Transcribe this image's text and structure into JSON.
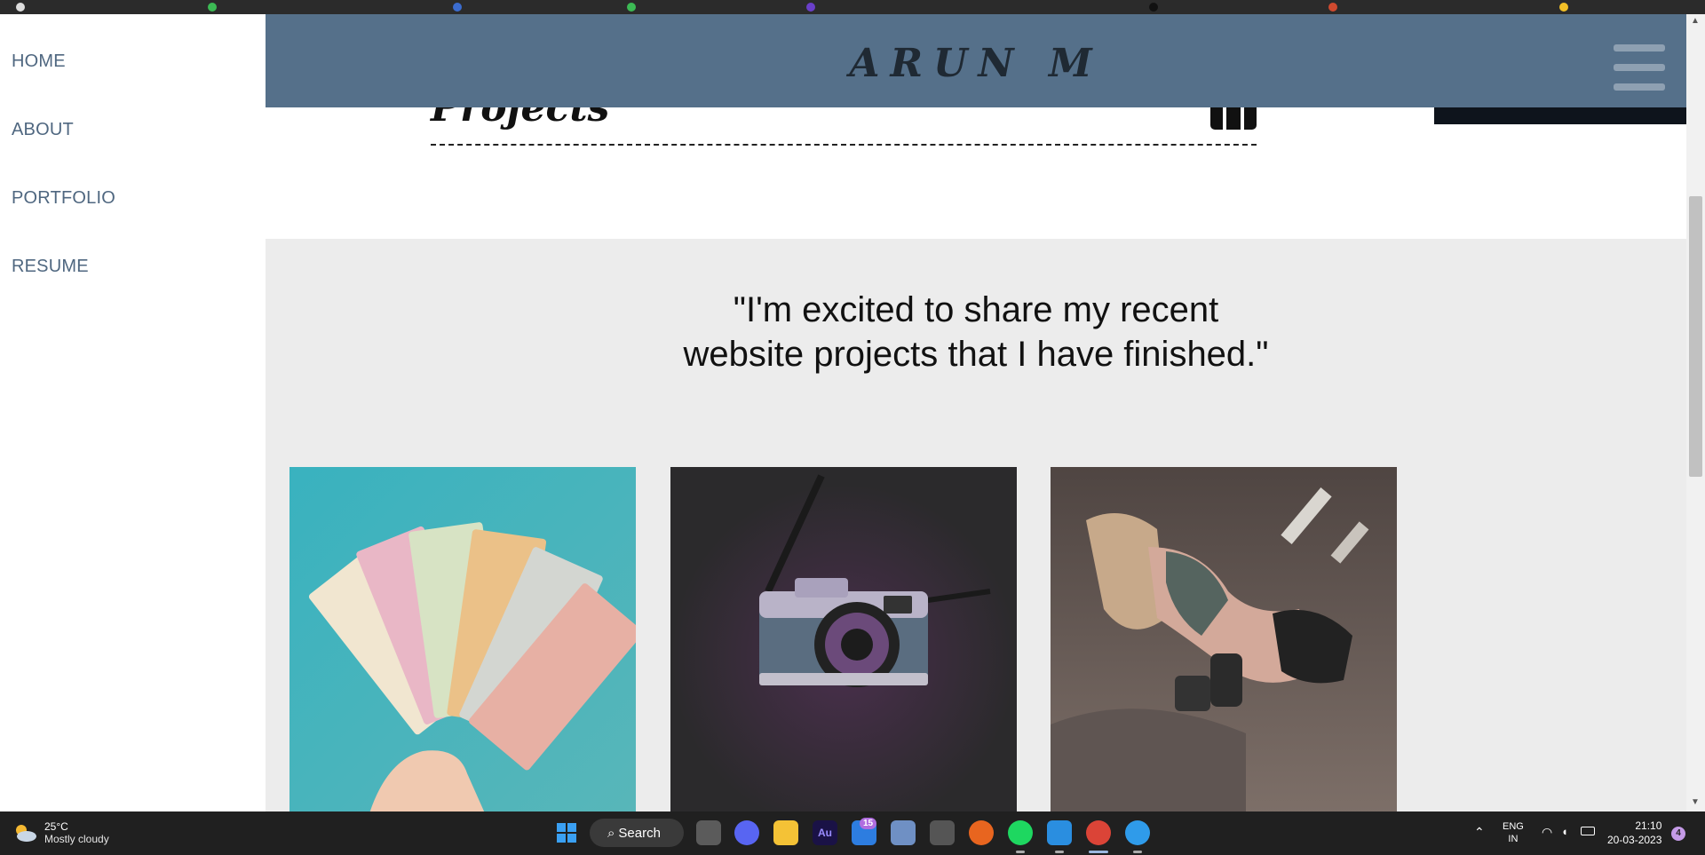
{
  "sidebar": {
    "items": [
      {
        "label": "HOME"
      },
      {
        "label": "ABOUT"
      },
      {
        "label": "PORTFOLIO"
      },
      {
        "label": "RESUME"
      }
    ]
  },
  "header": {
    "brand": "ARUN M",
    "menu_icon": "hamburger-icon",
    "background": "#55708a"
  },
  "projects": {
    "title": "Projects",
    "icon": "briefcase-icon"
  },
  "quote": {
    "line1": "\"I'm excited to share my recent",
    "line2": "website projects that I have finished.\""
  },
  "cards": [
    {
      "image": "money-fan-photo"
    },
    {
      "image": "camera-photo"
    },
    {
      "image": "fitness-photo"
    }
  ],
  "taskbar": {
    "weather": {
      "temp": "25°C",
      "condition": "Mostly cloudy"
    },
    "search_label": "Search",
    "mail_badge": "15",
    "language": {
      "line1": "ENG",
      "line2": "IN"
    },
    "time": "21:10",
    "date": "20-03-2023",
    "notifications": "4",
    "apps": [
      "windows-start-icon",
      "task-view-icon",
      "meet-icon",
      "file-explorer-icon",
      "audition-icon",
      "mail-icon",
      "remote-desktop-icon",
      "app-icon",
      "firefox-icon",
      "spotify-icon",
      "vscode-icon",
      "chrome-icon",
      "lightbulb-icon"
    ]
  },
  "colors": {
    "nav_text": "#4f6780",
    "section_gray": "#ececec",
    "taskbar": "#202020"
  }
}
